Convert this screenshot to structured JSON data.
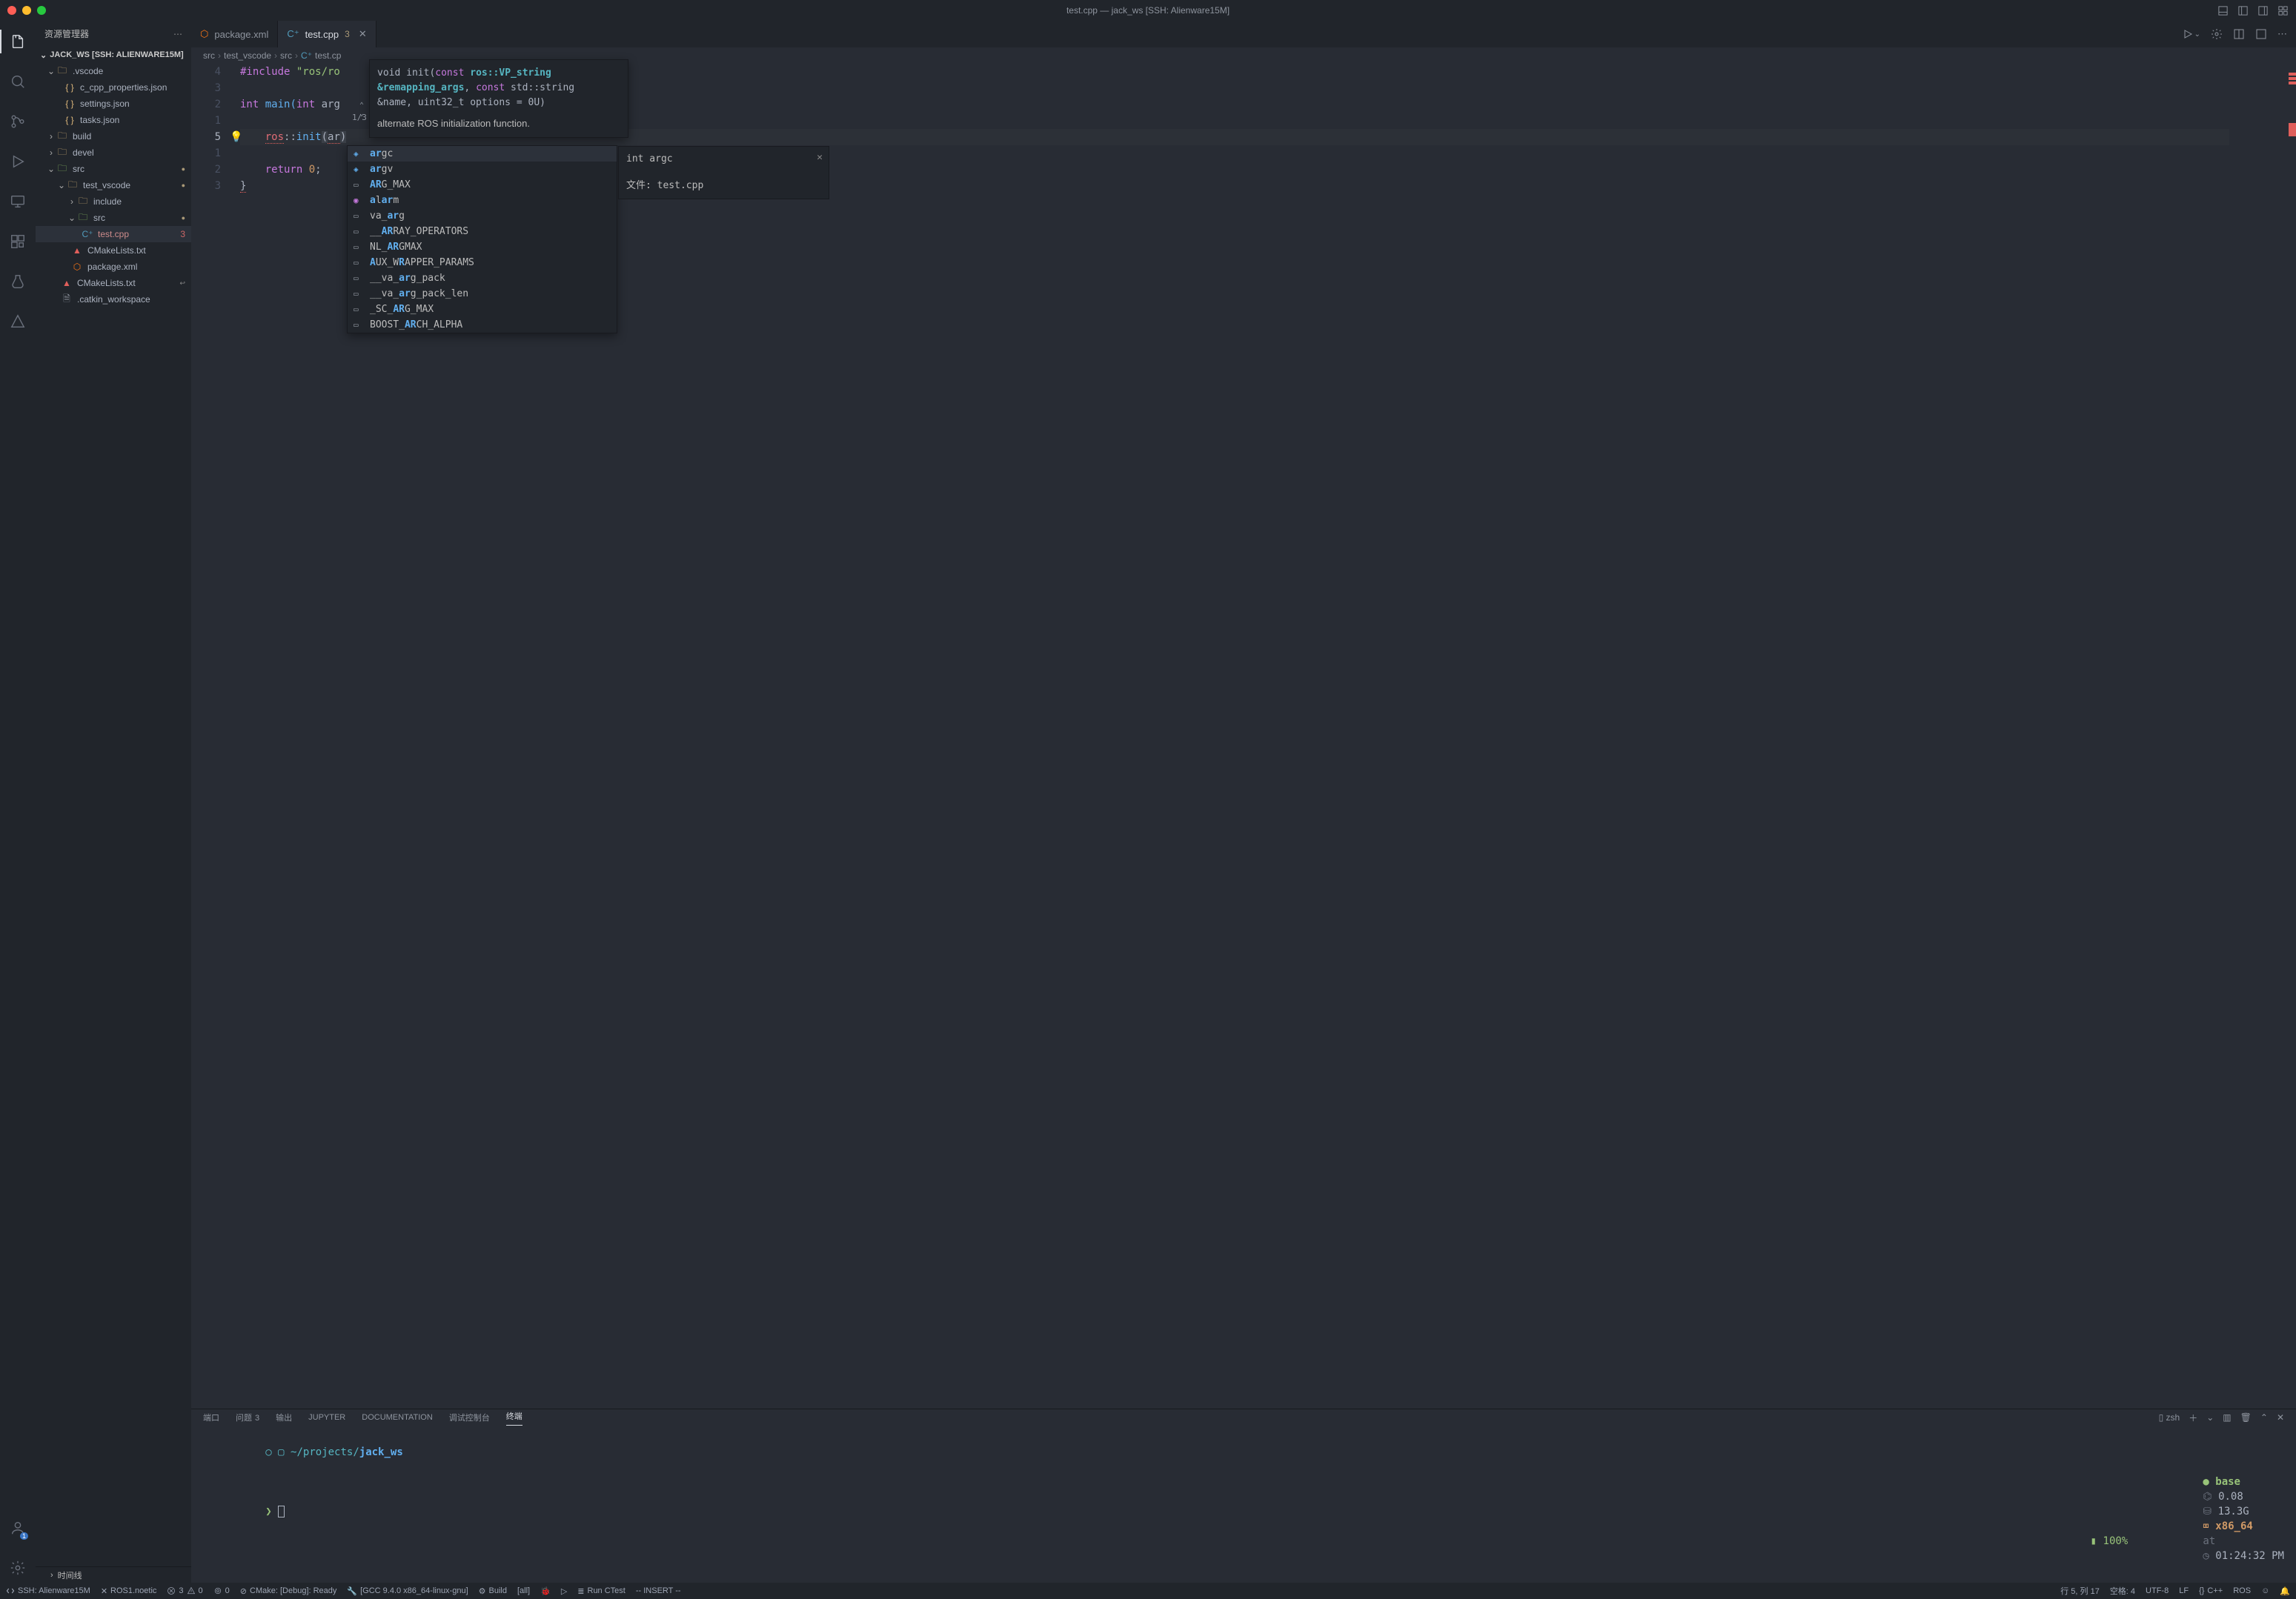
{
  "titlebar": {
    "title": "test.cpp — jack_ws [SSH: Alienware15M]"
  },
  "sidebar": {
    "header": "资源管理器",
    "section_title": "JACK_WS [SSH: ALIENWARE15M]",
    "timeline": "时间线"
  },
  "tree": {
    "vscode": ".vscode",
    "c_cpp_props": "c_cpp_properties.json",
    "settings": "settings.json",
    "tasks": "tasks.json",
    "build": "build",
    "devel": "devel",
    "src": "src",
    "test_vscode": "test_vscode",
    "include": "include",
    "src2": "src",
    "test_cpp": "test.cpp",
    "test_cpp_badge": "3",
    "cmake1": "CMakeLists.txt",
    "package_xml": "package.xml",
    "cmake2": "CMakeLists.txt",
    "catkin": ".catkin_workspace"
  },
  "tabs": {
    "t1_label": "package.xml",
    "t2_label": "test.cpp",
    "t2_badge": "3"
  },
  "breadcrumbs": {
    "b1": "src",
    "b2": "test_vscode",
    "b3": "src",
    "b4": "test.cp"
  },
  "gutter": [
    "4",
    "3",
    "2",
    "1",
    "5",
    "1",
    "2",
    "3"
  ],
  "code": {
    "l1_pre": "#include ",
    "l1_str": "\"ros/ro",
    "l3_int": "int",
    "l3_main": " main(",
    "l3_intarg": "int",
    "l3_arg": " arg",
    "l5_pre": "    ",
    "l5_ns": "ros",
    "l5_colon": "::",
    "l5_init": "init",
    "l5_open": "(",
    "l5_ar": "ar",
    "l5_close": ")",
    "l7_pre": "    ",
    "l7_ret": "return",
    "l7_zero": " 0",
    "l7_semi": ";",
    "l8": "}"
  },
  "sig_help": {
    "void": "void ",
    "init": "init(",
    "const1": "const",
    "type1": " ros::VP_string ",
    "param1": "&remapping_args",
    "comma1": ", ",
    "const2": "const",
    "type2": " std::string &name, uint32_t options = 0U)",
    "count": "1/3",
    "desc": "alternate ROS initialization function."
  },
  "suggest": [
    {
      "icon": "var",
      "pre": "",
      "hi": "ar",
      "post": "gc"
    },
    {
      "icon": "var",
      "pre": "",
      "hi": "ar",
      "post": "gv"
    },
    {
      "icon": "const",
      "pre": "",
      "hi": "AR",
      "post": "G_MAX"
    },
    {
      "icon": "field",
      "pre": "",
      "hi": "a",
      "post": "l",
      "hi2": "ar",
      "post2": "m"
    },
    {
      "icon": "const",
      "pre": "va_",
      "hi": "ar",
      "post": "g"
    },
    {
      "icon": "const",
      "pre": "__",
      "hi": "AR",
      "post": "RAY_OPERATORS"
    },
    {
      "icon": "const",
      "pre": "NL_",
      "hi": "AR",
      "post": "GMAX"
    },
    {
      "icon": "const",
      "pre": "",
      "hi": "A",
      "post": "UX_W",
      "hi2": "R",
      "post2": "APPER_PARAMS"
    },
    {
      "icon": "const",
      "pre": "__va_",
      "hi": "ar",
      "post": "g_pack"
    },
    {
      "icon": "const",
      "pre": "__va_",
      "hi": "ar",
      "post": "g_pack_len"
    },
    {
      "icon": "const",
      "pre": "_SC_",
      "hi": "AR",
      "post": "G_MAX"
    },
    {
      "icon": "const",
      "pre": "BOOST_",
      "hi": "AR",
      "post": "CH_ALPHA"
    }
  ],
  "suggest_detail": {
    "sig": "int argc",
    "file_label": "文件: ",
    "file": "test.cpp"
  },
  "panel_tabs": {
    "ports": "端口",
    "problems": "问题",
    "problems_count": "3",
    "output": "输出",
    "jupyter": "JUPYTER",
    "docs": "DOCUMENTATION",
    "debug": "调试控制台",
    "terminal": "终端",
    "shell": "zsh"
  },
  "terminal": {
    "prompt_icon": "○",
    "folder_icon": "▢",
    "path1": " ~/projects/",
    "path2": "jack_ws",
    "env_dot": "●",
    "env": " base ",
    "load_icon": "⌬",
    "load": " 0.08 ",
    "mem_icon": "⛁",
    "mem": " 13.3G ",
    "cpu_icon": "⌧",
    "cpu": " x86_64 ",
    "at": "at ",
    "clock_icon": "◷",
    "time": " 01:24:32 PM",
    "prompt2": "❯ ",
    "batt_icon": "▮",
    "batt": " 100%"
  },
  "statusbar": {
    "remote": "SSH: Alienware15M",
    "ros": "ROS1.noetic",
    "warnings": "3",
    "errors": "0",
    "ports": "0",
    "cmake": "CMake: [Debug]: Ready",
    "kit": "[GCC 9.4.0 x86_64-linux-gnu]",
    "build": "Build",
    "target": "[all]",
    "debug": "",
    "run": "",
    "ctest": "Run CTest",
    "insert": "-- INSERT --",
    "pos": "行 5, 列 17",
    "spaces": "空格: 4",
    "encoding": "UTF-8",
    "eol": "LF",
    "lang": "C++",
    "ros2": "ROS"
  }
}
